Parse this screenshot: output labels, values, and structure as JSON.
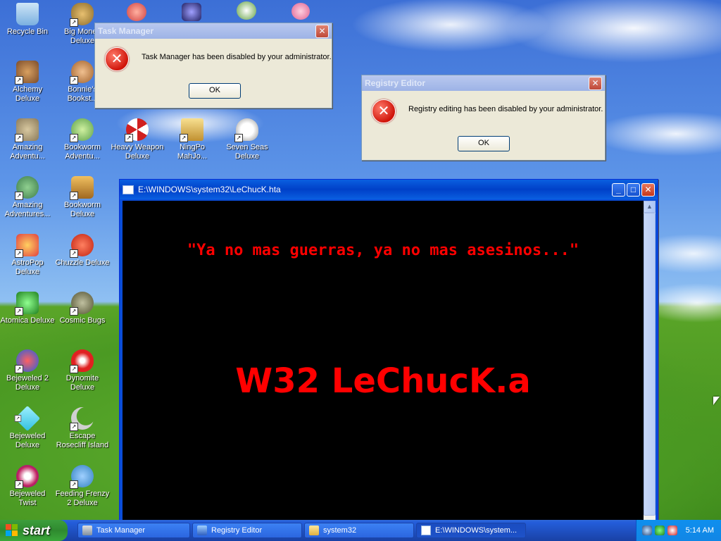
{
  "desktop": {
    "icons": [
      {
        "label": "Recycle Bin",
        "icon": "recycle-bin-icon",
        "color": "#7ab0e0"
      },
      {
        "label": "Big Money Deluxe",
        "icon": "money-bag-icon",
        "color": "#b8893a"
      },
      {
        "label": "Alchemy Deluxe",
        "icon": "wizard-icon",
        "color": "#7a4b2a"
      },
      {
        "label": "Bonnie's Bookst...",
        "icon": "bonnie-icon",
        "color": "#c9834a"
      },
      {
        "label": "Amazing Adventu...",
        "icon": "compass-icon",
        "color": "#8a7a5a"
      },
      {
        "label": "Bookworm Adventu...",
        "icon": "bookworm-icon",
        "color": "#5aa04a"
      },
      {
        "label": "Heavy Weapon Deluxe",
        "icon": "radiation-icon",
        "color": "#d02020"
      },
      {
        "label": "NingPo MahJo...",
        "icon": "mahjong-icon",
        "color": "#d8b040"
      },
      {
        "label": "Seven Seas Deluxe",
        "icon": "skull-icon",
        "color": "#e8e8e8"
      },
      {
        "label": "Amazing Adventures...",
        "icon": "globe-icon",
        "color": "#3a7a4a"
      },
      {
        "label": "Bookworm Deluxe",
        "icon": "book-icon",
        "color": "#c08a30"
      },
      {
        "label": "AstroPop Deluxe",
        "icon": "astropop-icon",
        "color": "#e04040"
      },
      {
        "label": "Chuzzle Deluxe",
        "icon": "chuzzle-icon",
        "color": "#e03020"
      },
      {
        "label": "Atomica Deluxe",
        "icon": "atomica-icon",
        "color": "#30c030"
      },
      {
        "label": "Cosmic Bugs",
        "icon": "bug-icon",
        "color": "#808060"
      },
      {
        "label": "Bejeweled 2 Deluxe",
        "icon": "bejeweled-icon",
        "color": "#2060e0"
      },
      {
        "label": "Dynomite Deluxe",
        "icon": "egg-icon",
        "color": "#e02020"
      },
      {
        "label": "Bejeweled Deluxe",
        "icon": "diamond-icon",
        "color": "#30c0e0"
      },
      {
        "label": "Escape Rosecliff Island",
        "icon": "moon-icon",
        "color": "#c0c0c0"
      },
      {
        "label": "Bejeweled Twist",
        "icon": "twist-icon",
        "color": "#c02060"
      },
      {
        "label": "Feeding Frenzy 2 Deluxe",
        "icon": "fish-icon",
        "color": "#3080c0"
      }
    ]
  },
  "task_manager_dialog": {
    "title": "Task Manager",
    "message": "Task Manager has been disabled by your administrator.",
    "ok": "OK"
  },
  "registry_dialog": {
    "title": "Registry Editor",
    "message": "Registry editing has been disabled by your administrator.",
    "ok": "OK"
  },
  "hta_window": {
    "title": "E:\\WINDOWS\\system32\\LeChucK.hta",
    "quote": "\"Ya no mas guerras, ya no mas asesinos...\"",
    "headline": "W32 LeChucK.a",
    "text_color": "#ff0000",
    "background": "#000000"
  },
  "taskbar": {
    "start_label": "start",
    "items": [
      {
        "label": "Task Manager"
      },
      {
        "label": "Registry Editor"
      },
      {
        "label": "system32"
      },
      {
        "label": "E:\\WINDOWS\\system..."
      }
    ],
    "clock": "5:14 AM"
  }
}
